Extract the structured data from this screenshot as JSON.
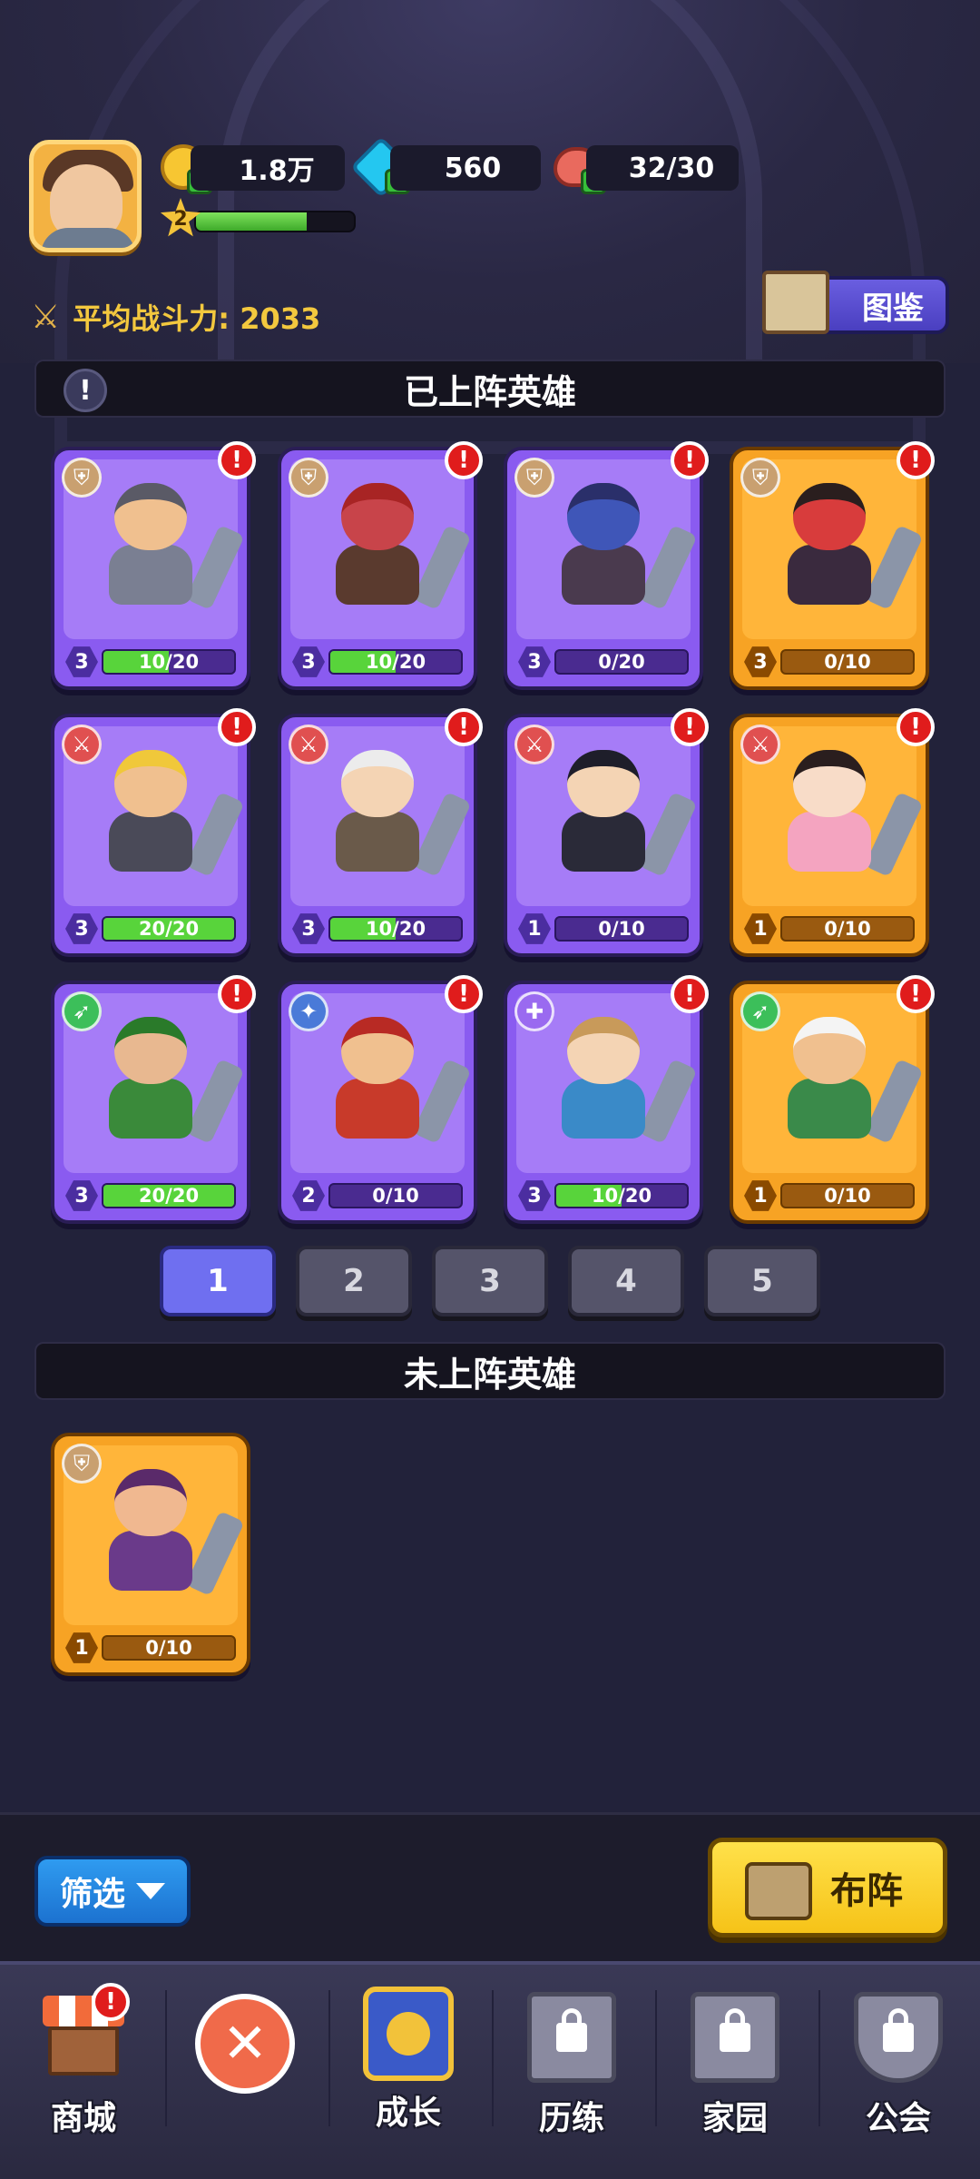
{
  "header": {
    "gold": "1.8万",
    "gems": "560",
    "stamina": "32/30",
    "player_level": "2",
    "xp_fraction": 0.7
  },
  "power": {
    "label": "平均战斗力: 2033"
  },
  "codex_button": "图鉴",
  "deployed_title": "已上阵英雄",
  "undeployed_title": "未上阵英雄",
  "deployed_heroes": [
    {
      "rarity": "purple",
      "class": "shield",
      "level": "3",
      "progress": "10/20",
      "fraction": 0.5,
      "alert": "!",
      "skin": "#f0c08f",
      "outfit": "#7a7f92",
      "hair": "#5a5a66"
    },
    {
      "rarity": "purple",
      "class": "shield",
      "level": "3",
      "progress": "10/20",
      "fraction": 0.5,
      "alert": "!",
      "skin": "#c8444a",
      "outfit": "#5a3a2e",
      "hair": "#a82424"
    },
    {
      "rarity": "purple",
      "class": "shield",
      "level": "3",
      "progress": "0/20",
      "fraction": 0,
      "alert": "!",
      "skin": "#3f56b8",
      "outfit": "#4a3a4e",
      "hair": "#2a2f6a"
    },
    {
      "rarity": "orange",
      "class": "shield",
      "level": "3",
      "progress": "0/10",
      "fraction": 0,
      "alert": "!",
      "skin": "#d83c3c",
      "outfit": "#3a2a3e",
      "hair": "#2a1e1e"
    },
    {
      "rarity": "purple",
      "class": "sword",
      "level": "3",
      "progress": "20/20",
      "fraction": 1,
      "alert": "!",
      "skin": "#f0c08f",
      "outfit": "#4a4a58",
      "hair": "#f0c83a"
    },
    {
      "rarity": "purple",
      "class": "sword",
      "level": "3",
      "progress": "10/20",
      "fraction": 0.5,
      "alert": "!",
      "skin": "#f4d4b4",
      "outfit": "#6a5a4a",
      "hair": "#ececec"
    },
    {
      "rarity": "purple",
      "class": "sword",
      "level": "1",
      "progress": "0/10",
      "fraction": 0,
      "alert": "!",
      "skin": "#f4d4b4",
      "outfit": "#2a2a38",
      "hair": "#1e1e2a"
    },
    {
      "rarity": "orange",
      "class": "sword",
      "level": "1",
      "progress": "0/10",
      "fraction": 0,
      "alert": "!",
      "skin": "#f8dcc8",
      "outfit": "#f4a4c0",
      "hair": "#2a1e1e"
    },
    {
      "rarity": "purple",
      "class": "bow",
      "level": "3",
      "progress": "20/20",
      "fraction": 1,
      "alert": "!",
      "skin": "#e8b890",
      "outfit": "#3a8a3a",
      "hair": "#2a7a2a"
    },
    {
      "rarity": "purple",
      "class": "magic",
      "level": "2",
      "progress": "0/10",
      "fraction": 0,
      "alert": "!",
      "skin": "#f0c08f",
      "outfit": "#c83a2a",
      "hair": "#b82a24"
    },
    {
      "rarity": "purple",
      "class": "heal",
      "level": "3",
      "progress": "10/20",
      "fraction": 0.5,
      "alert": "!",
      "skin": "#f4d4b4",
      "outfit": "#3a8ac8",
      "hair": "#c89a5a"
    },
    {
      "rarity": "orange",
      "class": "bow",
      "level": "1",
      "progress": "0/10",
      "fraction": 0,
      "alert": "!",
      "skin": "#f0c08f",
      "outfit": "#3a8a4a",
      "hair": "#f4f4f4"
    }
  ],
  "undeployed_heroes": [
    {
      "rarity": "orange",
      "class": "shield",
      "level": "1",
      "progress": "0/10",
      "fraction": 0,
      "skin": "#f0b890",
      "outfit": "#6a3a8a",
      "hair": "#5a2a6a"
    }
  ],
  "pages": [
    "1",
    "2",
    "3",
    "4",
    "5"
  ],
  "active_page": "1",
  "filter_button": "筛选",
  "formation_button": "布阵",
  "nav": [
    {
      "label": "商城",
      "icon": "shop-icon",
      "alert": "!"
    },
    {
      "label": "",
      "icon": "close-icon"
    },
    {
      "label": "成长",
      "icon": "growth-icon"
    },
    {
      "label": "历练",
      "icon": "scroll-locked-icon"
    },
    {
      "label": "家园",
      "icon": "castle-locked-icon"
    },
    {
      "label": "公会",
      "icon": "guild-shield-locked-icon"
    }
  ],
  "colors": {
    "purple_card": "#8a5bf0",
    "orange_card": "#f7a324",
    "progress_green": "#58d43b",
    "alert_red": "#e01c1c"
  }
}
